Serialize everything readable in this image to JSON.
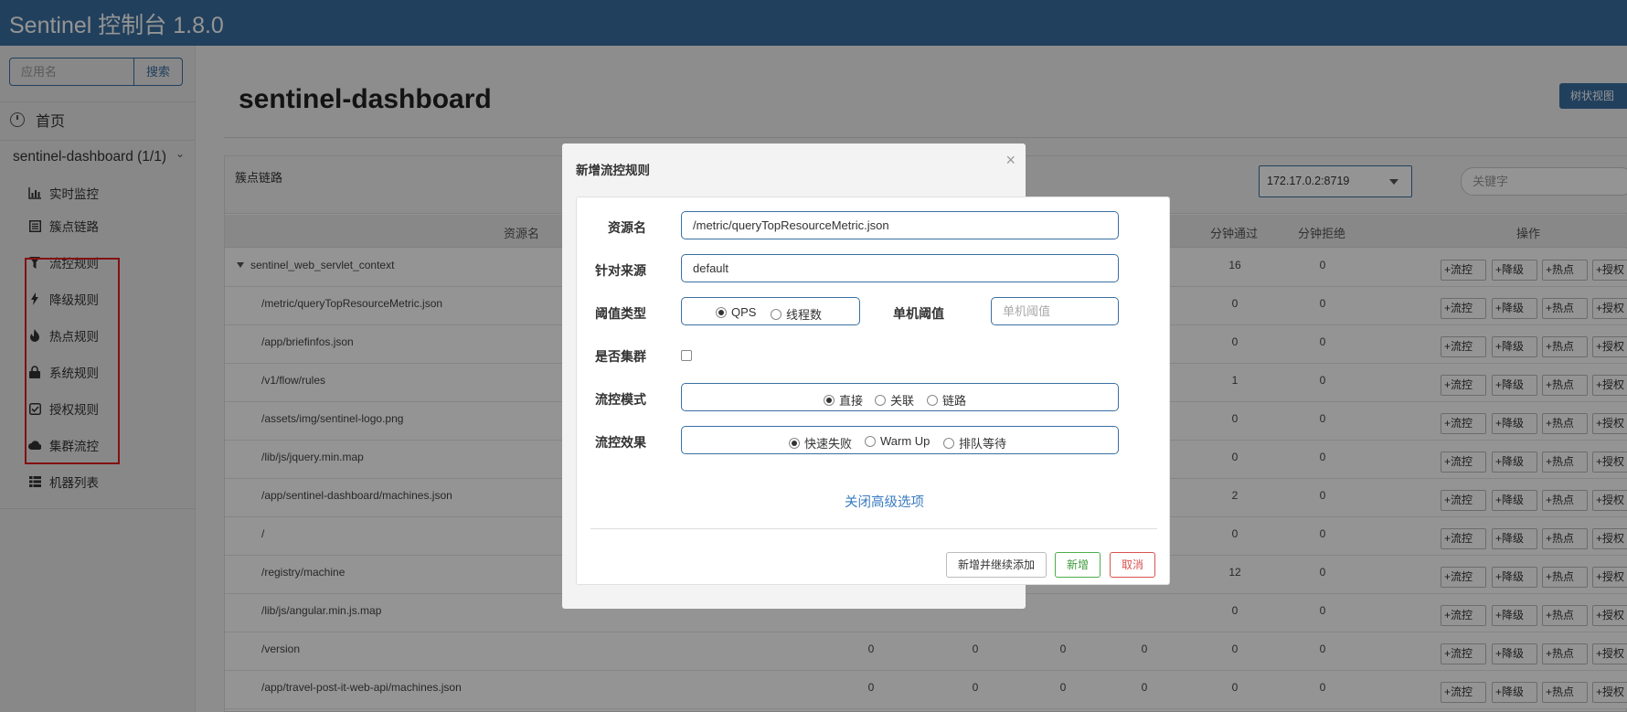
{
  "app": {
    "title": "Sentinel 控制台 1.8.0"
  },
  "sidebar": {
    "search_placeholder": "应用名",
    "search_button": "搜索",
    "home": "首页",
    "app_name": "sentinel-dashboard (1/1)",
    "items": [
      {
        "label": "实时监控",
        "icon": "bar-chart-icon"
      },
      {
        "label": "簇点链路",
        "icon": "list-icon"
      },
      {
        "label": "流控规则",
        "icon": "filter-icon"
      },
      {
        "label": "降级规则",
        "icon": "bolt-icon"
      },
      {
        "label": "热点规则",
        "icon": "fire-icon"
      },
      {
        "label": "系统规则",
        "icon": "lock-icon"
      },
      {
        "label": "授权规则",
        "icon": "check-square-icon"
      },
      {
        "label": "集群流控",
        "icon": "cloud-icon"
      },
      {
        "label": "机器列表",
        "icon": "grid-icon"
      }
    ]
  },
  "main": {
    "title": "sentinel-dashboard",
    "tree_view_button": "树状视图",
    "panel_title": "簇点链路",
    "machine_select": "172.17.0.2:8719",
    "keyword_placeholder": "关键字",
    "columns": {
      "resource": "资源名",
      "min_pass": "分钟通过",
      "min_block": "分钟拒绝",
      "ops": "操作"
    },
    "actions": [
      "+流控",
      "+降级",
      "+热点",
      "+授权"
    ],
    "rows": [
      {
        "resource": "sentinel_web_servlet_context",
        "min_pass": "16",
        "min_block": "0"
      },
      {
        "resource": "/metric/queryTopResourceMetric.json",
        "min_pass": "0",
        "min_block": "0"
      },
      {
        "resource": "/app/briefinfos.json",
        "min_pass": "0",
        "min_block": "0"
      },
      {
        "resource": "/v1/flow/rules",
        "min_pass": "1",
        "min_block": "0"
      },
      {
        "resource": "/assets/img/sentinel-logo.png",
        "min_pass": "0",
        "min_block": "0"
      },
      {
        "resource": "/lib/js/jquery.min.map",
        "min_pass": "0",
        "min_block": "0"
      },
      {
        "resource": "/app/sentinel-dashboard/machines.json",
        "min_pass": "2",
        "min_block": "0"
      },
      {
        "resource": "/",
        "min_pass": "0",
        "min_block": "0"
      },
      {
        "resource": "/registry/machine",
        "min_pass": "12",
        "min_block": "0"
      },
      {
        "resource": "/lib/js/angular.min.js.map",
        "min_pass": "0",
        "min_block": "0"
      },
      {
        "resource": "/version",
        "c1": "0",
        "c2": "0",
        "c3": "0",
        "c4": "0",
        "min_pass": "0",
        "min_block": "0"
      },
      {
        "resource": "/app/travel-post-it-web-api/machines.json",
        "c1": "0",
        "c2": "0",
        "c3": "0",
        "c4": "0",
        "min_pass": "0",
        "min_block": "0"
      }
    ]
  },
  "modal": {
    "title": "新增流控规则",
    "close": "×",
    "resource_label": "资源名",
    "resource_value": "/metric/queryTopResourceMetric.json",
    "origin_label": "针对来源",
    "origin_value": "default",
    "threshold_type_label": "阈值类型",
    "threshold_type_options": [
      "QPS",
      "线程数"
    ],
    "threshold_label": "单机阈值",
    "threshold_placeholder": "单机阈值",
    "cluster_label": "是否集群",
    "mode_label": "流控模式",
    "mode_options": [
      "直接",
      "关联",
      "链路"
    ],
    "effect_label": "流控效果",
    "effect_options": [
      "快速失败",
      "Warm Up",
      "排队等待"
    ],
    "advanced_link": "关闭高级选项",
    "btn_add_continue": "新增并继续添加",
    "btn_add": "新增",
    "btn_cancel": "取消"
  }
}
